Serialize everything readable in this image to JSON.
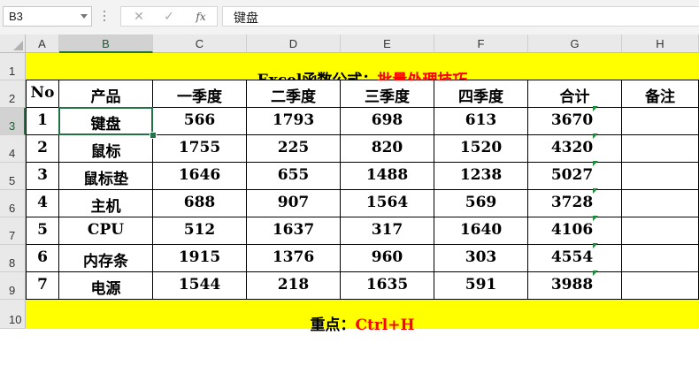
{
  "formula_bar": {
    "name_box": "B3",
    "cancel_glyph": "✕",
    "enter_glyph": "✓",
    "fx_label": "fx",
    "formula_text": "键盘"
  },
  "columns": [
    "A",
    "B",
    "C",
    "D",
    "E",
    "F",
    "G",
    "H"
  ],
  "rows": [
    "1",
    "2",
    "3",
    "4",
    "5",
    "6",
    "7",
    "8",
    "9",
    "10"
  ],
  "active_cell": "B3",
  "colors": {
    "band": "#ffff00",
    "highlight_text": "#ff0000",
    "selection": "#217346",
    "error_flag": "#1f8a3a"
  },
  "sheet": {
    "title_black": "Excel函数公式：",
    "title_red": "批量处理技巧",
    "headers": [
      "No",
      "产品",
      "一季度",
      "二季度",
      "三季度",
      "四季度",
      "合计",
      "备注"
    ],
    "data": [
      [
        "1",
        "键盘",
        "566",
        "1793",
        "698",
        "613",
        "3670",
        ""
      ],
      [
        "2",
        "鼠标",
        "1755",
        "225",
        "820",
        "1520",
        "4320",
        ""
      ],
      [
        "3",
        "鼠标垫",
        "1646",
        "655",
        "1488",
        "1238",
        "5027",
        ""
      ],
      [
        "4",
        "主机",
        "688",
        "907",
        "1564",
        "569",
        "3728",
        ""
      ],
      [
        "5",
        "CPU",
        "512",
        "1637",
        "317",
        "1640",
        "4106",
        ""
      ],
      [
        "6",
        "内存条",
        "1915",
        "1376",
        "960",
        "303",
        "4554",
        ""
      ],
      [
        "7",
        "电源",
        "1544",
        "218",
        "1635",
        "591",
        "3988",
        ""
      ]
    ],
    "note_black": "重点：",
    "note_red": "Ctrl+H"
  }
}
